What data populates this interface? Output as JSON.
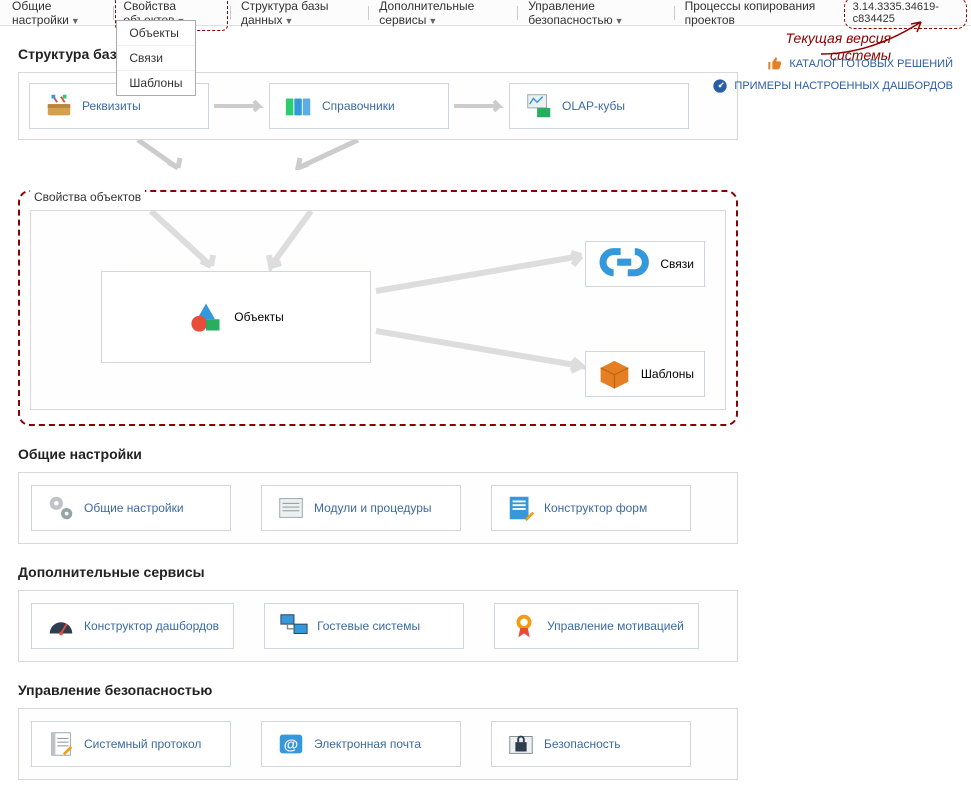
{
  "menu": {
    "general": "Общие настройки",
    "objprops": "Свойства объектов",
    "dbstruct": "Структура базы данных",
    "addons": "Дополнительные сервисы",
    "security": "Управление безопасностью",
    "copyproc": "Процессы копирования проектов"
  },
  "dropdown": {
    "objects": "Объекты",
    "links": "Связи",
    "templates": "Шаблоны"
  },
  "version": "3.14.3335.34619-c834425",
  "annotation": {
    "line1": "Текущая версия",
    "line2": "системы"
  },
  "rightlinks": {
    "catalog": "КАТАЛОГ ГОТОВЫХ РЕШЕНИЙ",
    "dashboards": "ПРИМЕРЫ НАСТРОЕННЫХ ДАШБОРДОВ"
  },
  "sections": {
    "dbstruct_title": "Структура базы данных",
    "requisites": "Реквизиты",
    "sprav": "Справочники",
    "olap": "OLAP-кубы",
    "objprops_title": "Свойства объектов",
    "objects": "Объекты",
    "links": "Связи",
    "templates": "Шаблоны",
    "general_title": "Общие настройки",
    "gen_settings": "Общие настройки",
    "modules": "Модули и процедуры",
    "formctor": "Конструктор форм",
    "addons_title": "Дополнительные сервисы",
    "dashctor": "Конструктор дашбордов",
    "guest": "Гостевые системы",
    "motiv": "Управление мотивацией",
    "security_title": "Управление безопасностью",
    "syslog": "Системный протокол",
    "email": "Электронная почта",
    "sec": "Безопасность"
  }
}
